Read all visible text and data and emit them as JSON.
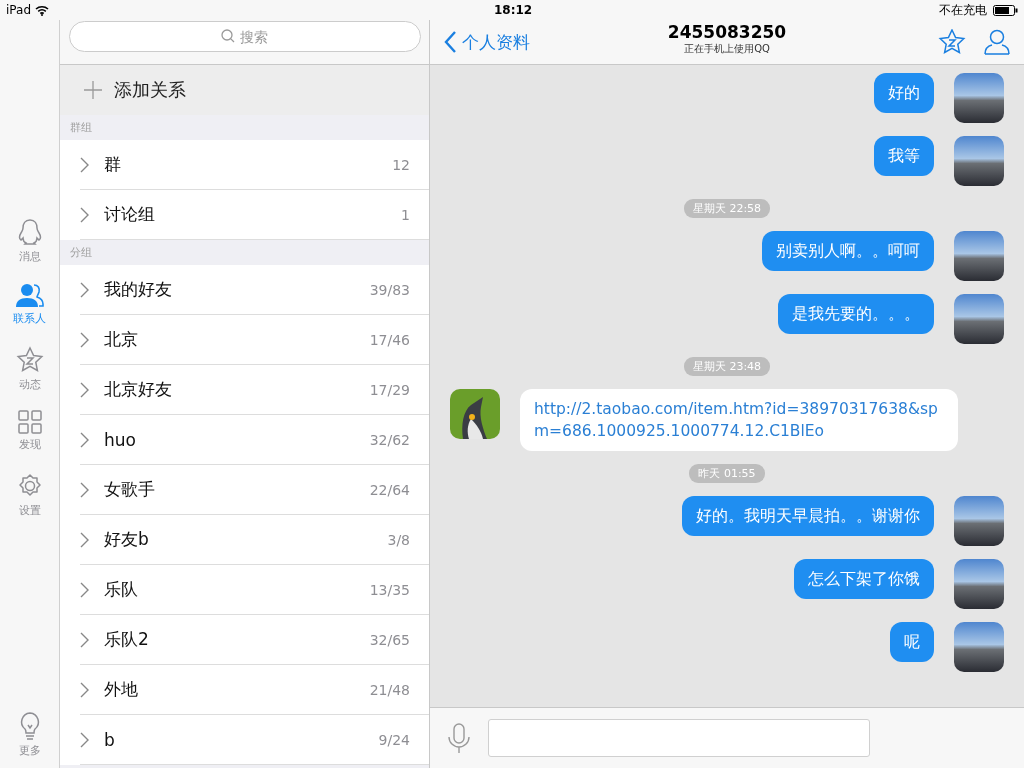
{
  "status_bar": {
    "device": "iPad",
    "time": "18:12",
    "charging": "不在充电"
  },
  "nav": [
    {
      "kind": "penguin",
      "label": "消息",
      "selected": false
    },
    {
      "kind": "contacts",
      "label": "联系人",
      "selected": true
    },
    {
      "kind": "star",
      "label": "动态",
      "selected": false
    },
    {
      "kind": "grid",
      "label": "发现",
      "selected": false
    },
    {
      "kind": "gear",
      "label": "设置",
      "selected": false
    }
  ],
  "nav_more": {
    "kind": "bulb",
    "label": "更多"
  },
  "contacts": {
    "search": {
      "placeholder": "搜索"
    },
    "add_button": "添加关系",
    "sections": [
      {
        "title": "群组",
        "items": [
          {
            "name": "群",
            "count": "12"
          },
          {
            "name": "讨论组",
            "count": "1"
          }
        ]
      },
      {
        "title": "分组",
        "items": [
          {
            "name": "我的好友",
            "count": "39/83"
          },
          {
            "name": "北京",
            "count": "17/46"
          },
          {
            "name": "北京好友",
            "count": "17/29"
          },
          {
            "name": "huo",
            "count": "32/62"
          },
          {
            "name": "女歌手",
            "count": "22/64"
          },
          {
            "name": "好友b",
            "count": "3/8"
          },
          {
            "name": "乐队",
            "count": "13/35"
          },
          {
            "name": "乐队2",
            "count": "32/65"
          },
          {
            "name": "外地",
            "count": "21/48"
          },
          {
            "name": "b",
            "count": "9/24"
          }
        ]
      }
    ]
  },
  "chat": {
    "back": "个人资料",
    "title": "2455083250",
    "subtitle": "正在手机上使用QQ",
    "messages": [
      {
        "kind": "sent",
        "text": "好的"
      },
      {
        "kind": "sent",
        "text": "我等"
      },
      {
        "kind": "time",
        "text": "星期天 22:58"
      },
      {
        "kind": "sent",
        "text": "别卖别人啊。。呵呵"
      },
      {
        "kind": "sent",
        "text": "是我先要的。。。"
      },
      {
        "kind": "time",
        "text": "星期天 23:48"
      },
      {
        "kind": "received_link",
        "text": "http://2.taobao.com/item.htm?id=38970317638&spm=686.1000925.1000774.12.C1BlEo"
      },
      {
        "kind": "time",
        "text": "昨天 01:55"
      },
      {
        "kind": "sent",
        "text": "好的。我明天早晨拍。。谢谢你"
      },
      {
        "kind": "sent",
        "text": "怎么下架了你饿"
      },
      {
        "kind": "sent",
        "text": "呢"
      }
    ]
  }
}
